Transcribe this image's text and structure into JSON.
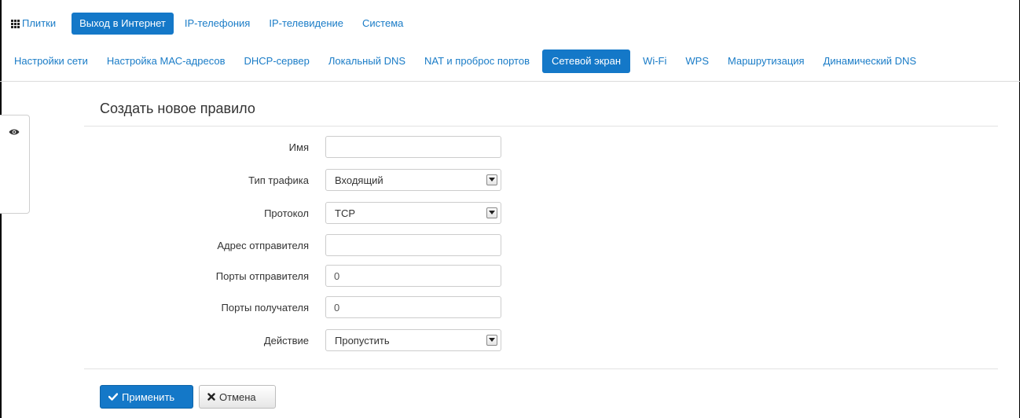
{
  "top_nav": {
    "items": [
      {
        "label": "Плитки",
        "icon": "tiles-icon",
        "active": false
      },
      {
        "label": "Выход в Интернет",
        "active": true
      },
      {
        "label": "IP-телефония",
        "active": false
      },
      {
        "label": "IP-телевидение",
        "active": false
      },
      {
        "label": "Система",
        "active": false
      }
    ]
  },
  "sub_nav": {
    "items": [
      {
        "label": "Настройки сети",
        "active": false
      },
      {
        "label": "Настройка МАС-адресов",
        "active": false
      },
      {
        "label": "DHCP-сервер",
        "active": false
      },
      {
        "label": "Локальный DNS",
        "active": false
      },
      {
        "label": "NAT и проброс портов",
        "active": false
      },
      {
        "label": "Сетевой экран",
        "active": true
      },
      {
        "label": "Wi-Fi",
        "active": false
      },
      {
        "label": "WPS",
        "active": false
      },
      {
        "label": "Маршрутизация",
        "active": false
      },
      {
        "label": "Динамический DNS",
        "active": false
      }
    ]
  },
  "side_panel": {
    "icon": "eye-icon"
  },
  "form": {
    "title": "Создать новое правило",
    "fields": [
      {
        "label": "Имя",
        "type": "text",
        "value": ""
      },
      {
        "label": "Тип трафика",
        "type": "select",
        "value": "Входящий"
      },
      {
        "label": "Протокол",
        "type": "select",
        "value": "TCP"
      },
      {
        "label": "Адрес отправителя",
        "type": "text",
        "value": ""
      },
      {
        "label": "Порты отправителя",
        "type": "text",
        "value": "0"
      },
      {
        "label": "Порты получателя",
        "type": "text",
        "value": "0"
      },
      {
        "label": "Действие",
        "type": "select",
        "value": "Пропустить"
      }
    ]
  },
  "buttons": {
    "apply_label": "Применить",
    "cancel_label": "Отмена"
  },
  "colors": {
    "accent": "#1478c8",
    "link": "#1a7cc7"
  }
}
